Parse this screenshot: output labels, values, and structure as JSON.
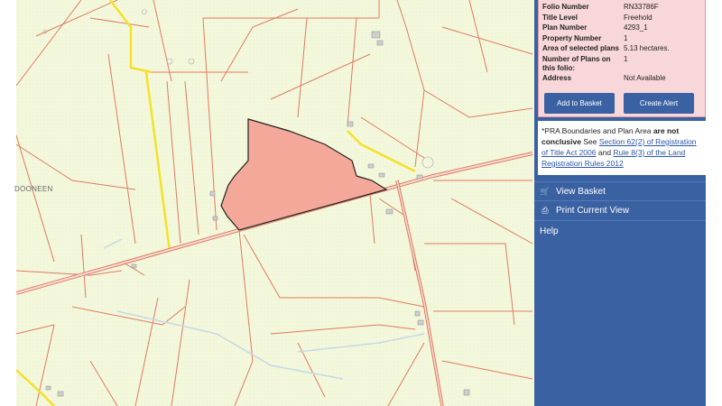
{
  "info_panel": {
    "rows": [
      {
        "label": "Folio Number",
        "value": "RN33786F"
      },
      {
        "label": "Title Level",
        "value": "Freehold"
      },
      {
        "label": "Plan Number",
        "value": "4293_1"
      },
      {
        "label": "Property Number",
        "value": "1"
      },
      {
        "label": "Area of selected plans",
        "value": "5.13 hectares."
      },
      {
        "label": "Number of Plans on this folio:",
        "value": "1"
      },
      {
        "label": "Address",
        "value": "Not Available"
      }
    ],
    "add_to_basket_label": "Add to Basket",
    "create_alert_label": "Create Alert"
  },
  "disclaimer": {
    "prefix": "*PRA Boundaries and Plan Area",
    "bold": "are not conclusive",
    "see": "See",
    "link1": "Section 62(2) of Registration of Title Act 2006",
    "and": "and",
    "link2": "Rule 8(3) of the Land Registration Rules 2012"
  },
  "menu": {
    "view_basket": "View Basket",
    "print_view": "Print Current View",
    "help": "Help"
  },
  "map": {
    "townland_label": "DOONEEN",
    "colors": {
      "background": "#f3f8dc",
      "boundary": "#e07a60",
      "road": "#f3e12a",
      "parcel_fill": "#f4a89a",
      "parcel_stroke": "#222222"
    }
  },
  "icons": {
    "basket": "basket-icon",
    "print": "printer-icon"
  }
}
